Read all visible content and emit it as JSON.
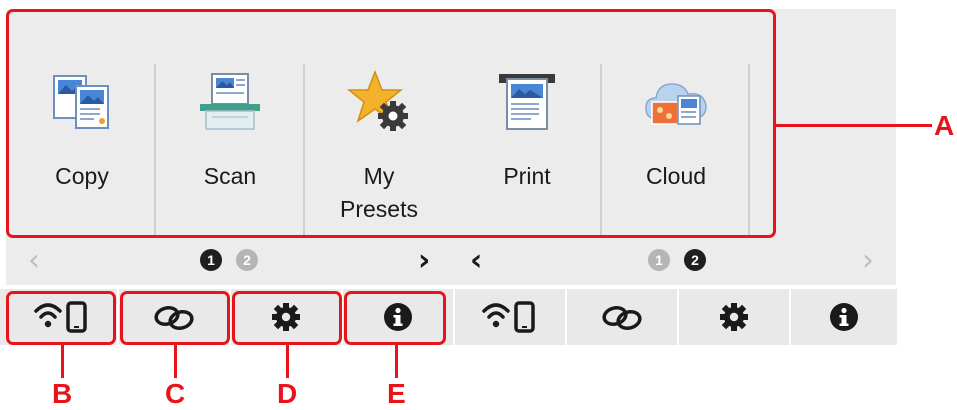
{
  "menu": {
    "items": [
      {
        "label": "Copy",
        "icon": "copy-icon"
      },
      {
        "label": "Scan",
        "icon": "scan-icon"
      },
      {
        "label": "My\nPresets",
        "icon": "my-presets-icon"
      },
      {
        "label": "Print",
        "icon": "print-icon"
      },
      {
        "label": "Cloud",
        "icon": "cloud-icon"
      }
    ]
  },
  "pager_left": {
    "page1": "1",
    "page2": "2",
    "prev": "‹",
    "next": "›"
  },
  "pager_right": {
    "page1": "1",
    "page2": "2",
    "prev": "‹",
    "next": "›"
  },
  "bottom_bar": {
    "buttons": [
      {
        "icon": "wifi-phone-icon"
      },
      {
        "icon": "link-icon"
      },
      {
        "icon": "settings-gear-icon"
      },
      {
        "icon": "info-icon"
      },
      {
        "icon": "wifi-phone-icon"
      },
      {
        "icon": "link-icon"
      },
      {
        "icon": "settings-gear-icon"
      },
      {
        "icon": "info-icon"
      }
    ]
  },
  "callouts": {
    "a": "A",
    "b": "B",
    "c": "C",
    "d": "D",
    "e": "E"
  },
  "colors": {
    "callout_red": "#e8141c",
    "panel_gray": "#ececec"
  }
}
